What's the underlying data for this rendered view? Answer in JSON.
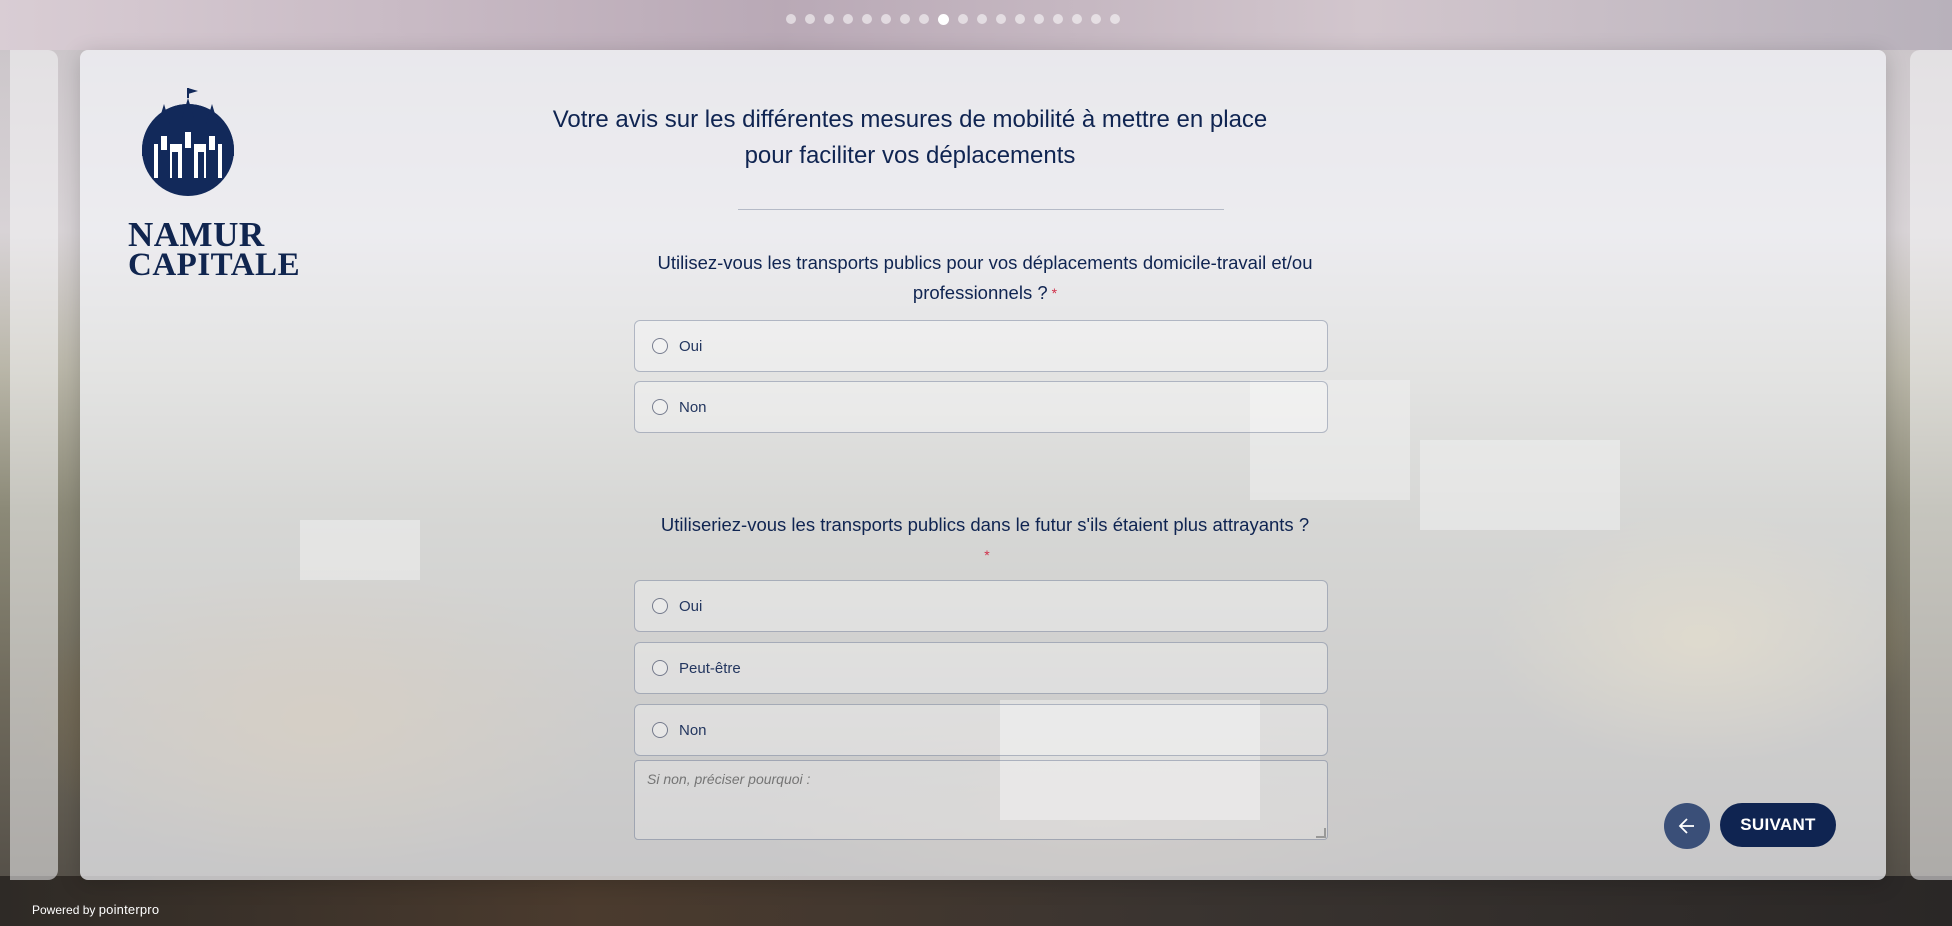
{
  "pager": {
    "count": 18,
    "active_index": 8
  },
  "logo": {
    "line1": "NAMUR",
    "line2": "CAPITALE",
    "icon": "castle-crest-icon"
  },
  "page_title": "Votre avis sur les différentes mesures de mobilité à mettre en place pour faciliter vos déplacements",
  "q1": {
    "text": "Utilisez-vous les transports publics pour vos déplacements domicile-travail et/ou professionnels ?",
    "required_mark": "*",
    "options": [
      "Oui",
      "Non"
    ]
  },
  "q2": {
    "text": "Utiliseriez-vous les transports publics dans le futur s'ils étaient plus attrayants ?",
    "required_mark": "*",
    "options": [
      "Oui",
      "Peut-être",
      "Non"
    ],
    "comment_placeholder": "Si non, préciser pourquoi :"
  },
  "nav": {
    "back_icon": "arrow-left-icon",
    "next_label": "SUIVANT"
  },
  "footer": {
    "powered_prefix": "Powered by",
    "brand": "pointerpro"
  },
  "colors": {
    "primary": "#0f2451",
    "required": "#d0304a",
    "back_button": "#3a4f78"
  }
}
